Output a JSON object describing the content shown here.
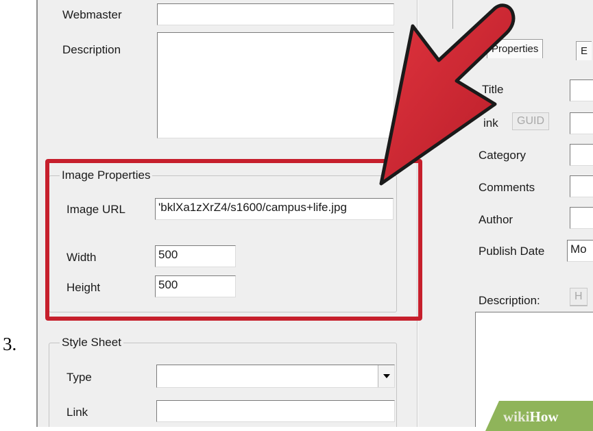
{
  "step_number": "3.",
  "site_panel": {
    "webmaster_label": "Webmaster",
    "description_label": "Description"
  },
  "image_properties": {
    "title": "Image Properties",
    "image_url_label": "Image URL",
    "image_url_value": "'bklXa1zXrZ4/s1600/campus+life.jpg",
    "width_label": "Width",
    "width_value": "500",
    "height_label": "Height",
    "height_value": "500"
  },
  "style_sheet": {
    "title": "Style Sheet",
    "type_label": "Type",
    "type_value": "",
    "link_label": "Link",
    "link_value": ""
  },
  "item_panel": {
    "tabs": [
      {
        "label": "Properties"
      },
      {
        "label": "E"
      }
    ],
    "title_label": "Title",
    "link_label": "ink",
    "guid_button": "GUID",
    "category_label": "Category",
    "comments_label": "Comments",
    "author_label": "Author",
    "publish_date_label": "Publish Date",
    "publish_date_value": "Mo",
    "description_label": "Description:",
    "html_button": "H"
  },
  "watermark": {
    "part1": "wiki",
    "part2": "How"
  },
  "colors": {
    "highlight_red": "#c61f2c",
    "window_bg": "#efefef",
    "watermark_green": "#8fb45a"
  }
}
